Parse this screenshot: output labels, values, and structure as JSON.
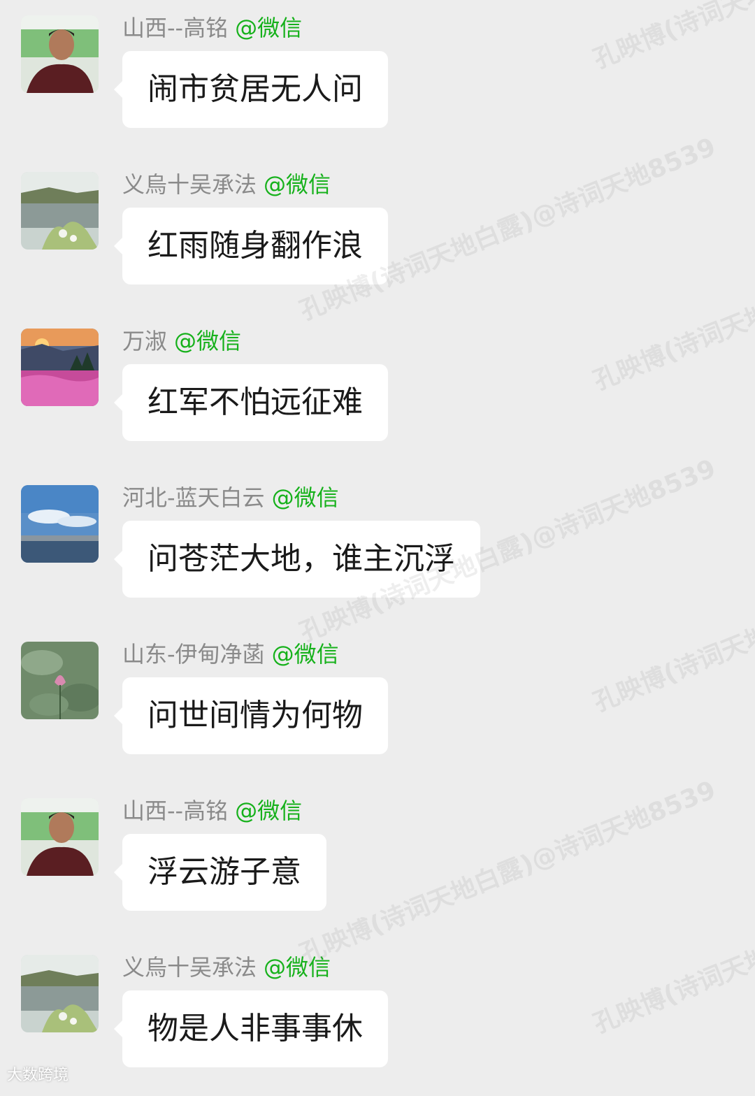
{
  "messages": [
    {
      "sender": "山西--高铭",
      "platform": "@微信",
      "avatar": "portrait-photo",
      "text": "闹市贫居无人问"
    },
    {
      "sender": "义烏十吴承法",
      "platform": "@微信",
      "avatar": "lake-landscape-photo",
      "text": "红雨随身翻作浪"
    },
    {
      "sender": "万淑",
      "platform": "@微信",
      "avatar": "sunset-flowers-photo",
      "text": "红军不怕远征难"
    },
    {
      "sender": "河北-蓝天白云",
      "platform": "@微信",
      "avatar": "sea-sky-photo",
      "text": "问苍茫大地，谁主沉浮"
    },
    {
      "sender": "山东-伊甸净菡",
      "platform": "@微信",
      "avatar": "lotus-photo",
      "text": "问世间情为何物"
    },
    {
      "sender": "山西--高铭",
      "platform": "@微信",
      "avatar": "portrait-photo",
      "text": "浮云游子意"
    },
    {
      "sender": "义烏十吴承法",
      "platform": "@微信",
      "avatar": "lake-landscape-photo",
      "text": "物是人非事事休"
    }
  ],
  "watermarks": [
    "孔映博(诗词天地白露)@诗词天地8539"
  ],
  "corner_logo": "大数跨境",
  "colors": {
    "background": "#ededed",
    "bubble": "#ffffff",
    "sender_name": "#8a8a8a",
    "platform_tag": "#16b11b",
    "message_text": "#1a1a1a"
  }
}
